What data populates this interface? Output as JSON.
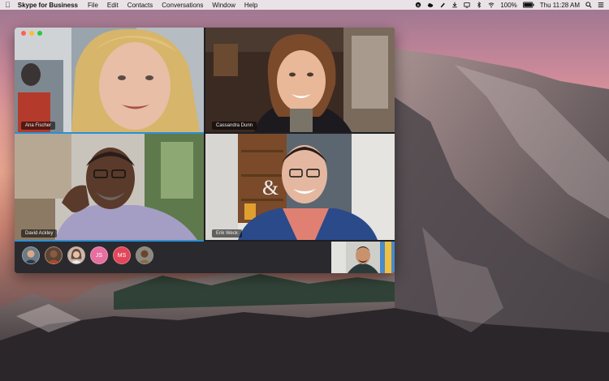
{
  "menubar": {
    "apple_icon": "apple-icon",
    "app_name": "Skype for Business",
    "menus": [
      "File",
      "Edit",
      "Contacts",
      "Conversations",
      "Window",
      "Help"
    ],
    "status": {
      "battery": "100%",
      "clock": "Thu 11:28 AM"
    }
  },
  "call": {
    "participants": [
      {
        "name": "Ana Fischer"
      },
      {
        "name": "Cassandra Dunn"
      },
      {
        "name": "David Ackley"
      },
      {
        "name": "Erik Weck"
      }
    ],
    "roster": [
      {
        "initials": "",
        "kind": "photo",
        "color": "#6b7a86"
      },
      {
        "initials": "",
        "kind": "photo",
        "color": "#8a5b40"
      },
      {
        "initials": "",
        "kind": "photo",
        "color": "#b48d7a"
      },
      {
        "initials": "JS",
        "kind": "initials",
        "color": "#e66ea0"
      },
      {
        "initials": "MS",
        "kind": "initials",
        "color": "#e2465a"
      },
      {
        "initials": "",
        "kind": "photo",
        "color": "#7a6a5a"
      }
    ]
  },
  "colors": {
    "active_speaker": "#2b8fd6",
    "window_bg": "#1f1e22"
  }
}
